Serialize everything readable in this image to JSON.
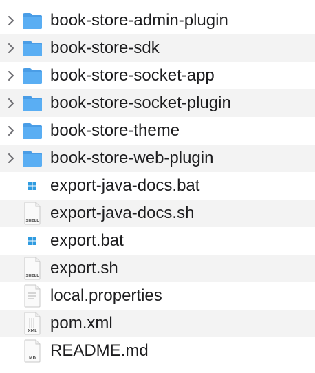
{
  "items": [
    {
      "name": "book-store-admin-plugin",
      "kind": "folder",
      "expandable": true,
      "icon": "folder-icon"
    },
    {
      "name": "book-store-sdk",
      "kind": "folder",
      "expandable": true,
      "icon": "folder-icon"
    },
    {
      "name": "book-store-socket-app",
      "kind": "folder",
      "expandable": true,
      "icon": "folder-icon"
    },
    {
      "name": "book-store-socket-plugin",
      "kind": "folder",
      "expandable": true,
      "icon": "folder-icon"
    },
    {
      "name": "book-store-theme",
      "kind": "folder",
      "expandable": true,
      "icon": "folder-icon"
    },
    {
      "name": "book-store-web-plugin",
      "kind": "folder",
      "expandable": true,
      "icon": "folder-icon"
    },
    {
      "name": "export-java-docs.bat",
      "kind": "bat",
      "expandable": false,
      "icon": "windows-batch-file-icon"
    },
    {
      "name": "export-java-docs.sh",
      "kind": "shell",
      "expandable": false,
      "icon": "shell-script-file-icon",
      "badge": "SHELL"
    },
    {
      "name": "export.bat",
      "kind": "bat",
      "expandable": false,
      "icon": "windows-batch-file-icon"
    },
    {
      "name": "export.sh",
      "kind": "shell",
      "expandable": false,
      "icon": "shell-script-file-icon",
      "badge": "SHELL"
    },
    {
      "name": "local.properties",
      "kind": "text",
      "expandable": false,
      "icon": "text-file-icon"
    },
    {
      "name": "pom.xml",
      "kind": "xml",
      "expandable": false,
      "icon": "xml-file-icon",
      "badge": "XML"
    },
    {
      "name": "README.md",
      "kind": "md",
      "expandable": false,
      "icon": "markdown-file-icon",
      "badge": "MD"
    }
  ],
  "colors": {
    "folder": "#5aaef3",
    "folder_tab": "#4a9de6",
    "row_alt": "#f3f3f3",
    "text": "#1d1d1f",
    "chevron": "#6e6e73",
    "windows_logo": "#2f9be0"
  }
}
